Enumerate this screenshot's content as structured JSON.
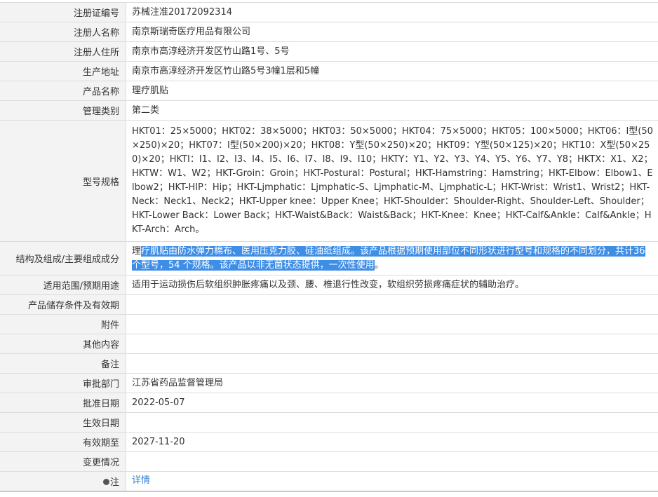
{
  "rows": [
    {
      "label": "注册证编号",
      "value": "苏械注准20172092314"
    },
    {
      "label": "注册人名称",
      "value": "南京斯瑞奇医疗用品有限公司"
    },
    {
      "label": "注册人住所",
      "value": "南京市高淳经济开发区竹山路1号、5号"
    },
    {
      "label": "生产地址",
      "value": "南京市高淳经济开发区竹山路5号3幢1层和5幢"
    },
    {
      "label": "产品名称",
      "value": "理疗肌贴"
    },
    {
      "label": "管理类别",
      "value": "第二类"
    },
    {
      "label": "型号规格",
      "value": "HKT01：25×5000；HKT02：38×5000；HKT03：50×5000；HKT04：75×5000；HKT05：100×5000；HKT06：I型(50×250)×20；HKT07：I型(50×200)×20；HKT08：Y型(50×250)×20；HKT09：Y型(50×125)×20；HKT10：X型(50×250)×20；HKTI：I1、I2、I3、I4、I5、I6、I7、I8、I9、I10；HKTY：Y1、Y2、Y3、Y4、Y5、Y6、Y7、Y8；HKTX：X1、X2；HKTW：W1、W2；HKT-Groin：Groin；HKT-Postural：Postural；HKT-Hamstring：Hamstring；HKT-Elbow：Elbow1、Elbow2；HKT-HIP：Hip；HKT-Ljmphatic：Ljmphatic-S、Ljmphatic-M、Ljmphatic-L；HKT-Wrist：Wrist1、Wrist2；HKT-Neck：Neck1、Neck2；HKT-Upper knee：Upper Knee；HKT-Shoulder：Shoulder-Right、Shoulder-Left、Shoulder；HKT-Lower Back：Lower Back；HKT-Waist&Back：Waist&Back；HKT-Knee：Knee；HKT-Calf&Ankle：Calf&Ankle；HKT-Arch：Arch。"
    },
    {
      "label": "结构及组成/主要组成成分",
      "value_prefix": "理",
      "value_selected": "疗肌贴由防水弹力棉布、医用压克力胶、硅油纸组成。该产品根据预期使用部位不同形状进行型号和规格的不同划分，共计36 个型号，54 个规格。该产品以非无菌状态提供，一次性使用",
      "value_suffix": "。"
    },
    {
      "label": "适用范围/预期用途",
      "value": "适用于运动损伤后软组织肿胀疼痛以及颈、腰、椎退行性改变，软组织劳损疼痛症状的辅助治疗。"
    },
    {
      "label": "产品储存条件及有效期",
      "value": ""
    },
    {
      "label": "附件",
      "value": ""
    },
    {
      "label": "其他内容",
      "value": ""
    },
    {
      "label": "备注",
      "value": ""
    },
    {
      "label": "审批部门",
      "value": "江苏省药品监督管理局"
    },
    {
      "label": "批准日期",
      "value": "2022-05-07"
    },
    {
      "label": "生效日期",
      "value": ""
    },
    {
      "label": "有效期至",
      "value": "2027-11-20"
    },
    {
      "label": "变更情况",
      "value": ""
    },
    {
      "label": "注",
      "icon": "location-pin-icon",
      "link_text": "详情"
    }
  ]
}
